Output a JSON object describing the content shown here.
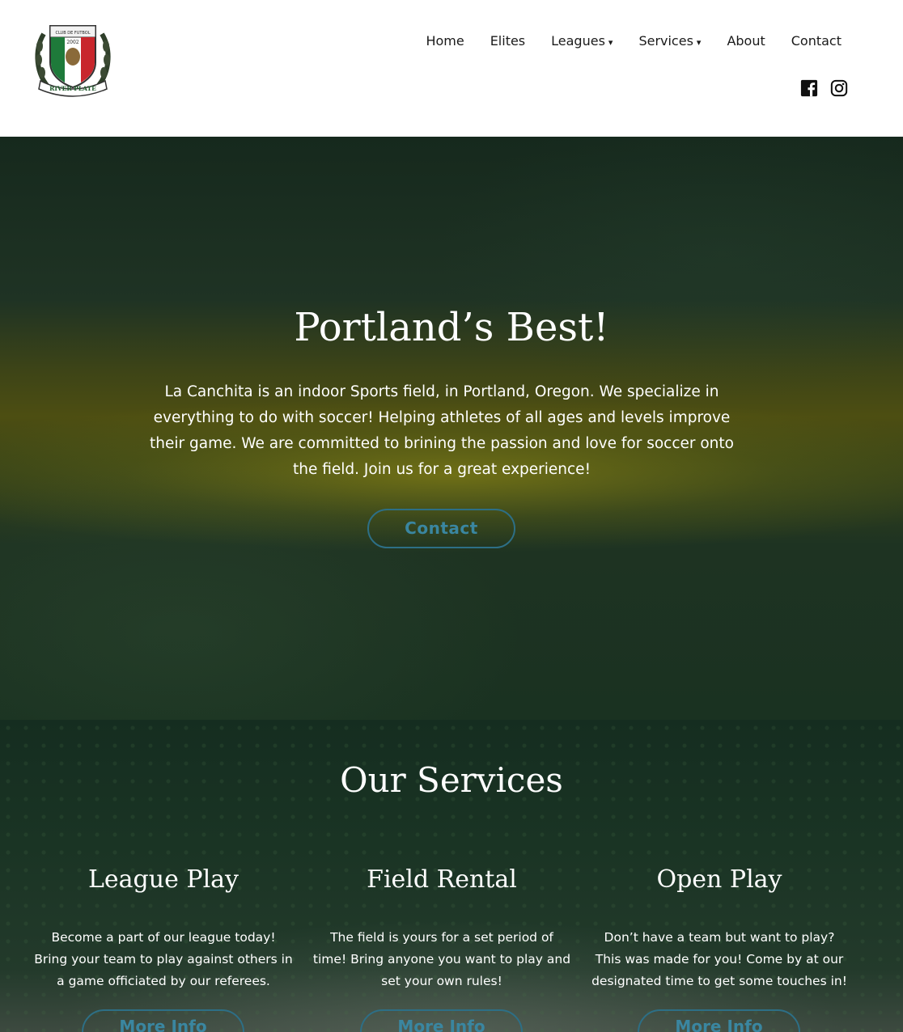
{
  "header": {
    "logo": {
      "text_top": "CLUB DE FUTBOL",
      "year": "2002",
      "banner": "RIVER PLATE",
      "icon": "river-plate-crest-logo"
    },
    "nav": [
      {
        "label": "Home"
      },
      {
        "label": "Elites"
      },
      {
        "label": "Leagues",
        "caret": "▾"
      },
      {
        "label": "Services",
        "caret": "▾"
      },
      {
        "label": "About"
      },
      {
        "label": "Contact"
      }
    ],
    "social": [
      {
        "icon": "facebook-icon"
      },
      {
        "icon": "instagram-icon"
      }
    ]
  },
  "hero": {
    "title": "Portland’s Best!",
    "text": "La Canchita is an indoor Sports field, in Portland, Oregon. We specialize in everything to do with soccer! Helping athletes of all ages and levels improve their game. We are committed to brining the passion and love for soccer onto the field. Join us for a great experience!",
    "button": "Contact"
  },
  "services": {
    "title": "Our Services",
    "items": [
      {
        "title": "League Play",
        "text": "Become a part of our league today! Bring your team to play against others in a game officiated by our referees.",
        "button": "More Info"
      },
      {
        "title": "Field Rental",
        "text": "The field is yours for a set period of time! Bring anyone you want to play and set your own rules!",
        "button": "More Info"
      },
      {
        "title": "Open Play",
        "text": "Don’t have a team but want to play? This was made for you! Come by at our designated time to get some touches in!",
        "button": "More Info"
      }
    ]
  },
  "colors": {
    "accent": "#2d6f86",
    "accent_text": "#3a86a0"
  }
}
